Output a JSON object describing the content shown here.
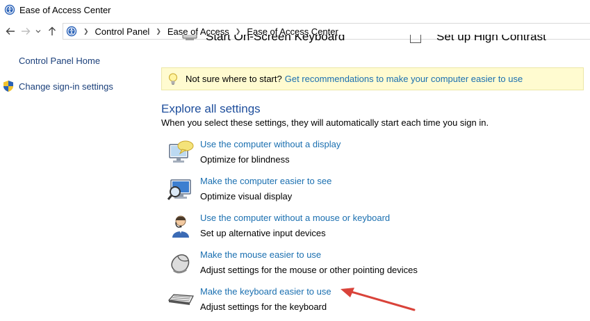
{
  "window": {
    "title": "Ease of Access Center"
  },
  "navigation": {
    "back_icon": "arrow-left",
    "forward_icon": "arrow-right",
    "recent_icon": "chevron-down",
    "up_icon": "arrow-up",
    "breadcrumbs": [
      "Control Panel",
      "Ease of Access",
      "Ease of Access Center"
    ]
  },
  "sidebar": {
    "home_label": "Control Panel Home",
    "signin_label": "Change sign-in settings"
  },
  "main": {
    "partial_items": [
      "Start On-Screen Keyboard",
      "Set up High Contrast"
    ],
    "tip": {
      "text": "Not sure where to start?",
      "link": "Get recommendations to make your computer easier to use"
    },
    "section_title": "Explore all settings",
    "section_subtitle": "When you select these settings, they will automatically start each time you sign in.",
    "settings": [
      {
        "link": "Use the computer without a display",
        "desc": "Optimize for blindness",
        "icon": "monitor-speech-icon"
      },
      {
        "link": "Make the computer easier to see",
        "desc": "Optimize visual display",
        "icon": "monitor-magnifier-icon"
      },
      {
        "link": "Use the computer without a mouse or keyboard",
        "desc": "Set up alternative input devices",
        "icon": "person-headset-icon"
      },
      {
        "link": "Make the mouse easier to use",
        "desc": "Adjust settings for the mouse or other pointing devices",
        "icon": "mouse-icon"
      },
      {
        "link": "Make the keyboard easier to use",
        "desc": "Adjust settings for the keyboard",
        "icon": "keyboard-icon"
      }
    ]
  },
  "colors": {
    "link": "#1a6fb0",
    "section_title": "#1e4e9c",
    "tip_background": "#fffbd0",
    "annotation_arrow": "#d9433a"
  }
}
